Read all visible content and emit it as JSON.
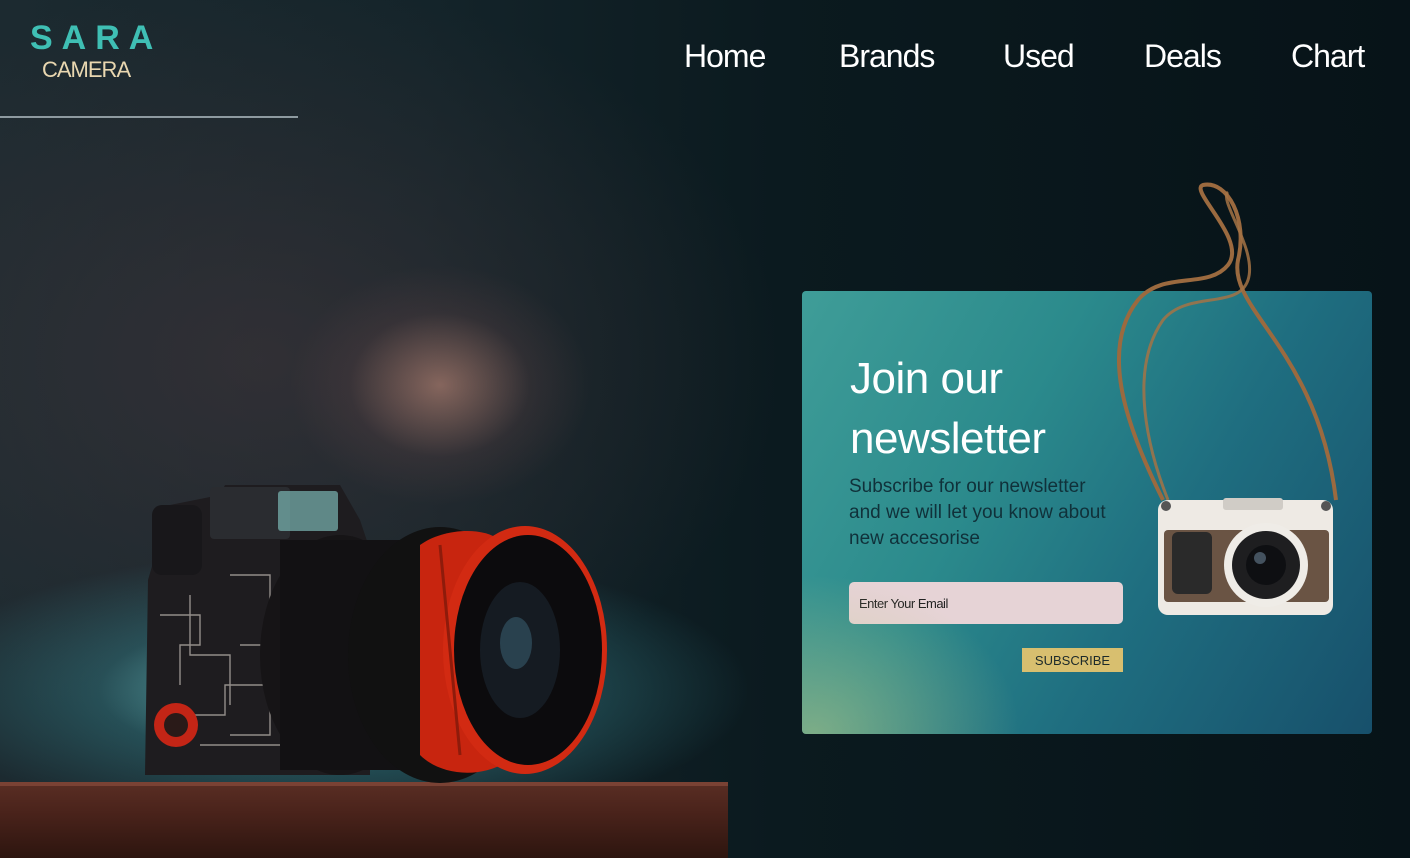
{
  "logo": {
    "line1": "SARA",
    "line2": "CAMERA"
  },
  "nav": {
    "items": [
      "Home",
      "Brands",
      "Used",
      "Deals",
      "Chart"
    ]
  },
  "newsletter": {
    "title": "Join our newsletter",
    "subtitle": "Subscribe for our newsletter and we will let you know about new accesorise",
    "email_placeholder": "Enter Your Email",
    "subscribe_label": "SUBSCRIBE"
  },
  "colors": {
    "logo_accent": "#3fbfb4",
    "card_start": "#3f9d98",
    "card_end": "#17506b",
    "subscribe_button": "#d8bf6f",
    "input_background": "#e6d3d6"
  },
  "hero_image": {
    "camera_icon": "camera-icon",
    "lens_color": "#d22a12"
  }
}
